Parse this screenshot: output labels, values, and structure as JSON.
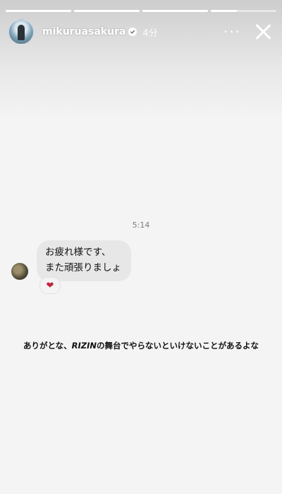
{
  "progress": {
    "segments": [
      1,
      1,
      1,
      0.4
    ]
  },
  "story": {
    "username": "mikuruasakura",
    "time_ago": "4分",
    "more_label": "···"
  },
  "dm": {
    "time": "5:14",
    "message_line1": "お疲れ様です、",
    "message_line2": "また頑張りましょ",
    "reaction": "❤"
  },
  "caption": {
    "before": "ありがとな、",
    "emphasis": "RIZIN",
    "after": "の舞台でやらないといけないことがあるよな"
  },
  "colors": {
    "background": "#f4f4f4",
    "bubble": "#e7e7e7",
    "heart": "#c3223b"
  }
}
